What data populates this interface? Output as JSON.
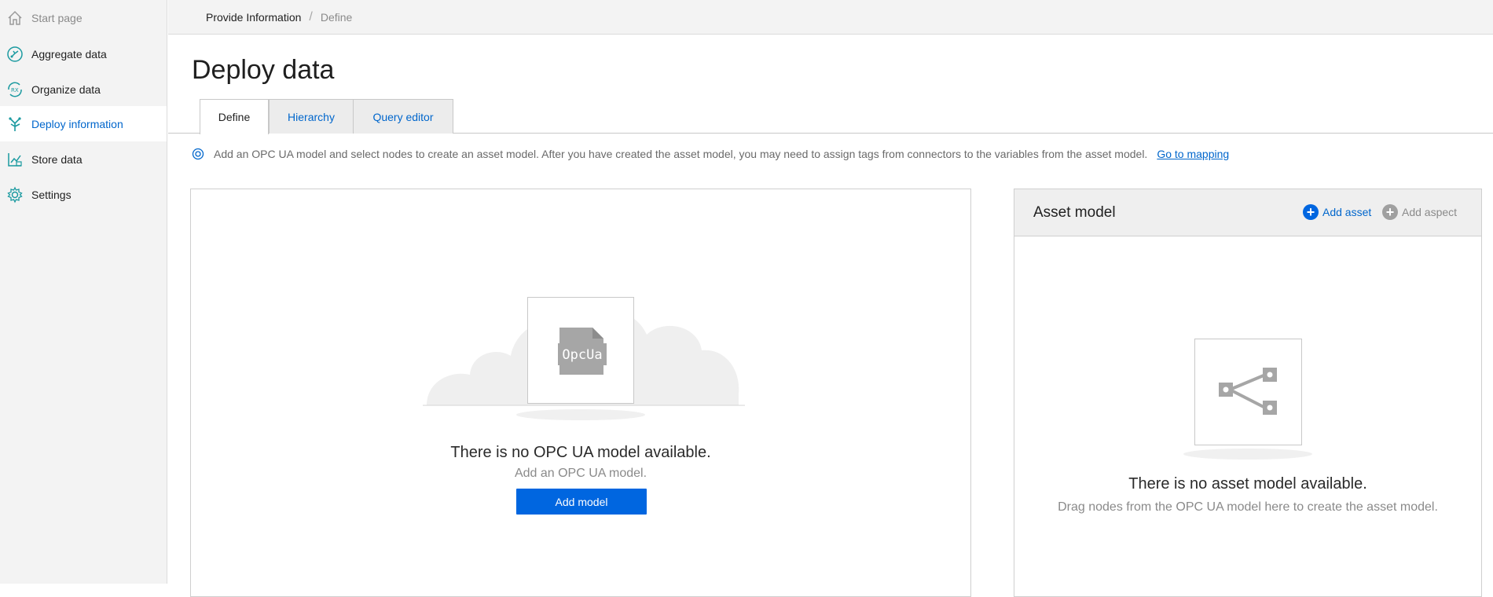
{
  "sidebar": {
    "items": [
      {
        "label": "Start page",
        "icon": "home-icon"
      },
      {
        "label": "Aggregate data",
        "icon": "aggregate-data-icon"
      },
      {
        "label": "Organize data",
        "icon": "organize-data-icon"
      },
      {
        "label": "Deploy information",
        "icon": "deploy-information-icon"
      },
      {
        "label": "Store data",
        "icon": "store-data-icon"
      },
      {
        "label": "Settings",
        "icon": "gear-icon"
      }
    ],
    "active_index": 3
  },
  "breadcrumb": {
    "parent": "Provide Information",
    "current": "Define"
  },
  "page": {
    "title": "Deploy data"
  },
  "tabs": [
    {
      "label": "Define",
      "active": true
    },
    {
      "label": "Hierarchy",
      "active": false
    },
    {
      "label": "Query editor",
      "active": false
    }
  ],
  "info": {
    "text": "Add an OPC UA model and select nodes to create an asset model. After you have created the asset model, you may need to assign tags from connectors to the variables from the asset model.",
    "link": "Go to mapping"
  },
  "opc_panel": {
    "icon_label": "OpcUa",
    "empty_title": "There is no OPC UA model available.",
    "empty_sub": "Add an OPC UA model.",
    "button": "Add model"
  },
  "asset_panel": {
    "title": "Asset model",
    "add_asset": "Add asset",
    "add_aspect": "Add aspect",
    "empty_title": "There is no asset model available.",
    "empty_sub": "Drag nodes from the OPC UA model here to create the asset model."
  },
  "colors": {
    "accent": "#0066cc",
    "button": "#0066e0",
    "sidebar_bg": "#f3f3f3",
    "teal_icon": "#1b9aa0"
  }
}
